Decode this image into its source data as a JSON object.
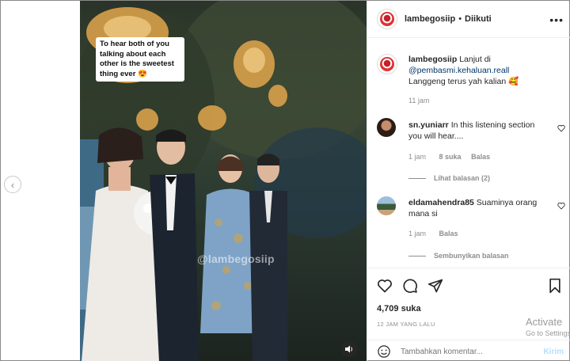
{
  "post": {
    "username": "lambegosiip",
    "follow_status": "Diikuti",
    "caption_mention": "@pembasmi.kehaluan.reall",
    "caption_prefix": "Lanjut di",
    "caption_line2": "Langgeng terus yah kalian 🥰",
    "caption_time": "11 jam",
    "video_caption": "To hear both of you talking about each other is the sweetest thing ever 😍",
    "video_watermark": "@lambegosiip"
  },
  "comments": [
    {
      "user": "sn.yuniarr",
      "text": "In this listening section you will hear....",
      "time": "1 jam",
      "likes": "8 suka",
      "reply_label": "Balas",
      "thread_label": "Lihat balasan (2)"
    },
    {
      "user": "eldamahendra85",
      "text": "Suaminya orang mana si",
      "time": "1 jam",
      "reply_label": "Balas",
      "thread_label": "Sembunyikan balasan"
    }
  ],
  "footer": {
    "likes": "4,709 suka",
    "posted": "12 JAM YANG LALU",
    "comment_placeholder": "Tambahkan komentar...",
    "post_label": "Kirim",
    "watermark_line1": "Activate",
    "watermark_line2": "Go to Settings"
  },
  "icons": {
    "prev": "chevron-left-icon",
    "more": "more-horizontal-icon",
    "like": "heart-icon",
    "comment": "comment-icon",
    "share": "send-icon",
    "save": "bookmark-icon",
    "emoji": "emoji-icon",
    "sound": "speaker-icon"
  }
}
